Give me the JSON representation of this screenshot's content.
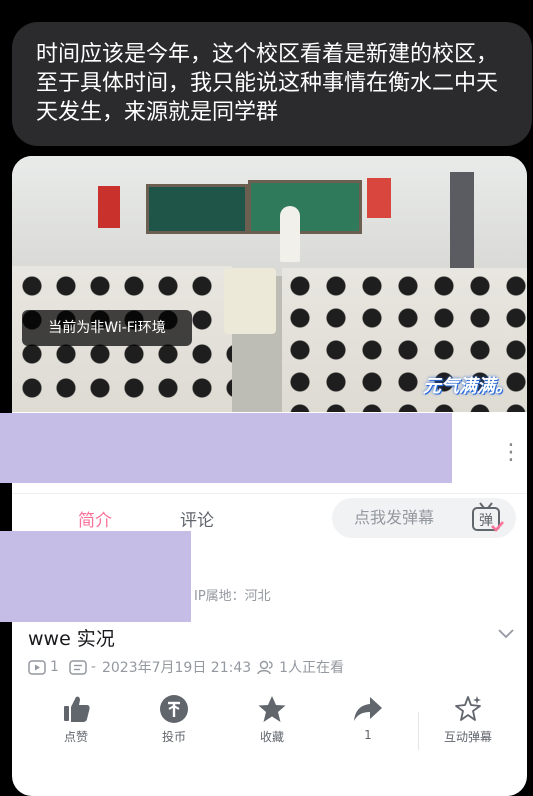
{
  "caption": {
    "text": "时间应该是今年，这个校区看着是新建的校区，至于具体时间，我只能说这种事情在衡水二中天天发生，来源就是同学群"
  },
  "player": {
    "wifi_notice": "当前为非Wi-Fi环境",
    "watermark": "元气满满。"
  },
  "tabs": {
    "intro": "简介",
    "comments": "评论"
  },
  "danmu": {
    "placeholder": "点我发弹幕",
    "icon_glyph": "弹"
  },
  "video_info": {
    "ip_location": "IP属地：河北",
    "title": "wwe 实况",
    "play_count": "1",
    "danmu_count": "-",
    "publish_time": "2023年7月19日  21:43",
    "watching": "1人正在看"
  },
  "actions": [
    {
      "label": "点赞",
      "icon": "thumbs-up-icon"
    },
    {
      "label": "投币",
      "icon": "coin-icon"
    },
    {
      "label": "收藏",
      "icon": "star-icon"
    },
    {
      "label": "1",
      "icon": "share-icon"
    },
    {
      "label": "互动弹幕",
      "icon": "sparkle-icon"
    }
  ],
  "colors": {
    "accent": "#fb7299",
    "redaction": "#c5bde5",
    "bubble_bg": "#2b2b2d"
  }
}
